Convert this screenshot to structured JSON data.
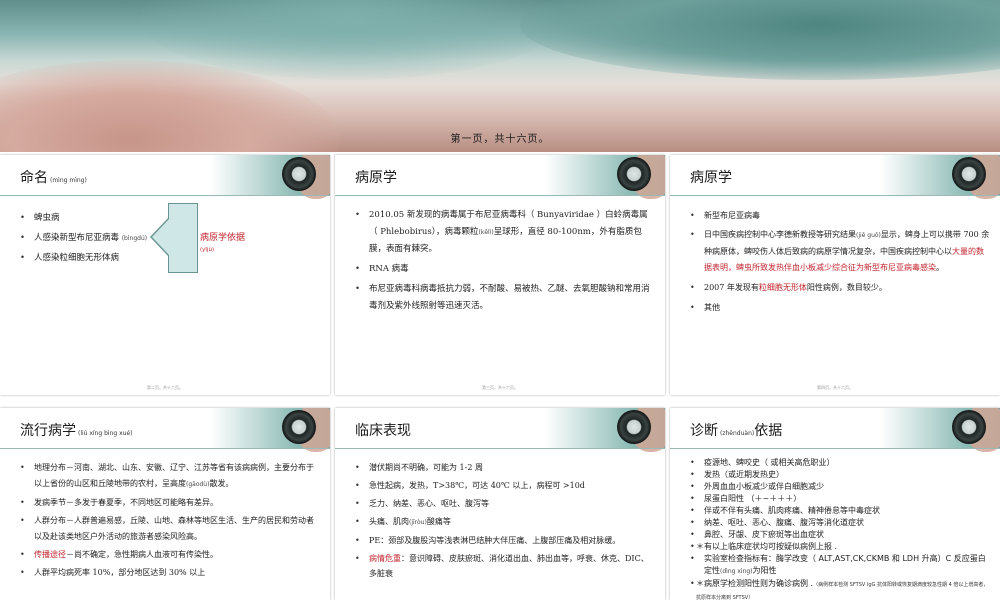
{
  "hero": {
    "caption": "第一页，共十六页。"
  },
  "slides": [
    {
      "title": "命名",
      "title_pinyin": "(mìng mìng)",
      "bullets": [
        "蜱虫病",
        "人感染新型布尼亚病毒",
        "人感染粒细胞无形体病"
      ],
      "bullet2_pinyin": "(bìngdú)",
      "callout": {
        "text": "病原学依据",
        "pinyin": "(yījù)"
      },
      "footer": "第二页，共十六页。"
    },
    {
      "title": "病原学",
      "bullets": [
        "2010.05 新发现的病毒属于布尼亚病毒科（ Bunyaviridae ）白蛉病毒属（ Phlebobirus），病毒颗粒",
        "呈球形，直径 80-100nm，外有脂质包膜，表面有棘突。",
        "RNA 病毒",
        "布尼亚病毒科病毒抵抗力弱，不耐酸、易被热、乙醚、去氧胆酸钠和常用消毒剂及紫外线照射等迅速灭活。"
      ],
      "bullet1_pinyin": "(kēlì)",
      "footer": "第三页，共十六页。"
    },
    {
      "title": "病原学",
      "b1": "新型布尼亚病毒",
      "b2_a": "日中国疾病控制中心李德新教授等研究结果",
      "b2_py": "(jiē guǒ)",
      "b2_b": "显示，蜱身上可以携带 700 余种病原体，蜱咬伤人体后致病的病原学情况复杂，中国疾病控制中心以",
      "b2_red1": "大量的数据表明，",
      "b2_red2": "蜱虫所致发热伴血小板减少综合征为新型布尼亚病毒感染",
      "b2_end": "。",
      "b3_a": "2007 年发现有",
      "b3_red": "粒细胞无形体",
      "b3_b": "阳性病例，数目较少。",
      "b4": "其他",
      "footer": "第四页，共十六页。"
    },
    {
      "title": "流行病学",
      "title_pinyin": "(liú xíng bìng xué)",
      "b1_a": "地理分布－河南、湖北、山东、安徽、辽宁、江苏等省有该病病例，主要分布于以上省份的山区和丘陵地带的农村，呈高度",
      "b1_py": "(gāodù)",
      "b1_b": "散发。",
      "b2": "发病季节－多发于春夏季，不同地区可能略有差异。",
      "b3": "人群分布－人群普遍易感，丘陵、山地、森林等地区生活、生产的居民和劳动者以及赴该类地区户外活动的旅游者感染风险高。",
      "b4_red": "传播途径",
      "b4_b": "－尚不确定，急性期病人血液可有传染性。",
      "b5": "人群平均病死率 10%，部分地区达到 30% 以上"
    },
    {
      "title": "临床表现",
      "b1": "潜伏期尚不明确，可能为 1-2 周",
      "b2": "急性起病，发热，T>38℃，可达 40℃ 以上，病程可 >10d",
      "b3": "乏力、纳差、恶心、呕吐、腹泻等",
      "b4_a": "头痛、肌肉",
      "b4_py": "(jīròu)",
      "b4_b": "酸痛等",
      "b5": "PE：颈部及腹股沟等浅表淋巴结肿大伴压痛、上腹部压痛及相对脉缓。",
      "b6_red": "病情危重",
      "b6_b": "：意识障碍、皮肤瘀斑、消化道出血、肺出血等，呼衰、休克、DIC、多脏衰"
    },
    {
      "title": "诊断",
      "title_pinyin": "(zhěnduàn)",
      "title_tail": "依据",
      "items": [
        "疫源地、蜱咬史（ 或相关高危职业）",
        "发热（或近期发热史）",
        "外周血血小板减少或伴白细胞减少",
        "尿蛋白阳性 （＋~＋＋＋）",
        "伴或不伴有头痛、肌肉疼痛、精神倦怠等中毒症状",
        "纳差、呕吐、恶心、腹痛、腹泻等消化道症状",
        "鼻腔、牙龈、皮下瘀斑等出血症状"
      ],
      "star1": "＊有以上临床症状均可按疑似病例上报 .",
      "lab_a": "实验室检查指标有：酶学改变（ ALT,AST,CK,CKMB 和 LDH 升高）C 反应蛋白定性",
      "lab_py": "(dìng xìng)",
      "lab_b": "为阳性",
      "star2": "＊病原学检测阳性则为确诊病例 .",
      "star2_note": "（病例样本检测 SFTSV IgG 抗体阳转或恢复期滴度较急性期 4 倍以上增高者，抗原样本分离到 SFTSV）"
    }
  ]
}
